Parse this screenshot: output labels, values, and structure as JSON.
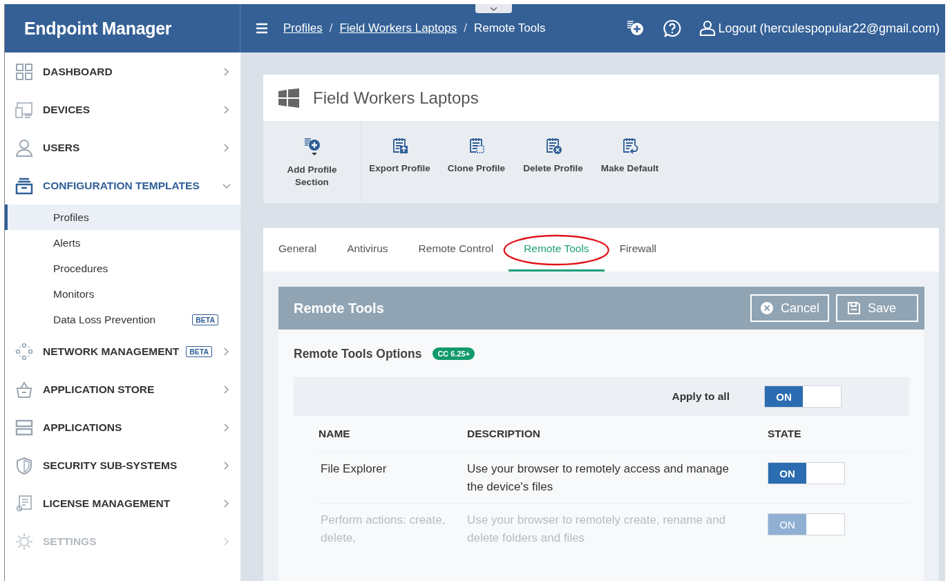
{
  "app": {
    "title": "Endpoint Manager"
  },
  "header": {
    "breadcrumbs": [
      {
        "label": "Profiles",
        "link": true
      },
      {
        "label": "Field Workers Laptops",
        "link": true
      },
      {
        "label": "Remote Tools",
        "link": false
      }
    ],
    "separator": "/",
    "user": "Logout (herculespopular22@gmail.com)"
  },
  "sidebar": {
    "items": [
      {
        "label": "DASHBOARD",
        "expanded": false,
        "disabled": false
      },
      {
        "label": "DEVICES",
        "expanded": false,
        "disabled": false
      },
      {
        "label": "USERS",
        "expanded": false,
        "disabled": false
      },
      {
        "label": "CONFIGURATION TEMPLATES",
        "expanded": true,
        "disabled": false,
        "children": [
          {
            "label": "Profiles",
            "selected": true
          },
          {
            "label": "Alerts",
            "selected": false
          },
          {
            "label": "Procedures",
            "selected": false
          },
          {
            "label": "Monitors",
            "selected": false
          },
          {
            "label": "Data Loss Prevention",
            "selected": false,
            "badge": "BETA"
          }
        ]
      },
      {
        "label": "NETWORK MANAGEMENT",
        "expanded": false,
        "disabled": false,
        "badge": "BETA"
      },
      {
        "label": "APPLICATION STORE",
        "expanded": false,
        "disabled": false
      },
      {
        "label": "APPLICATIONS",
        "expanded": false,
        "disabled": false
      },
      {
        "label": "SECURITY SUB-SYSTEMS",
        "expanded": false,
        "disabled": false
      },
      {
        "label": "LICENSE MANAGEMENT",
        "expanded": false,
        "disabled": false
      },
      {
        "label": "SETTINGS",
        "expanded": false,
        "disabled": true
      }
    ]
  },
  "profile": {
    "title": "Field Workers Laptops",
    "toolbar": [
      {
        "label": "Add Profile Section"
      },
      {
        "label": "Export Profile"
      },
      {
        "label": "Clone Profile"
      },
      {
        "label": "Delete Profile"
      },
      {
        "label": "Make Default"
      }
    ],
    "tabs": [
      {
        "label": "General",
        "selected": false,
        "annotated": false
      },
      {
        "label": "Antivirus",
        "selected": false,
        "annotated": false
      },
      {
        "label": "Remote Control",
        "selected": false,
        "annotated": false
      },
      {
        "label": "Remote Tools",
        "selected": true,
        "annotated": true
      },
      {
        "label": "Firewall",
        "selected": false,
        "annotated": false
      }
    ]
  },
  "section": {
    "title": "Remote Tools",
    "buttons": [
      {
        "label": "Cancel"
      },
      {
        "label": "Save"
      }
    ],
    "options_title": "Remote Tools Options",
    "version_badge": "CC 6.25+",
    "apply_all": {
      "label": "Apply to all",
      "toggle": {
        "on": true,
        "label": "ON"
      }
    },
    "table": {
      "columns": [
        "NAME",
        "DESCRIPTION",
        "STATE"
      ],
      "rows": [
        {
          "name": "File Explorer",
          "description": "Use your browser to remotely access and manage the device's files",
          "toggle": {
            "on": true,
            "label": "ON"
          },
          "disabled": false
        },
        {
          "name": "Perform actions: create, delete,",
          "description": "Use your browser to remotely create, rename and delete folders and files",
          "toggle": {
            "on": true,
            "label": "ON"
          },
          "disabled": true
        }
      ]
    }
  }
}
